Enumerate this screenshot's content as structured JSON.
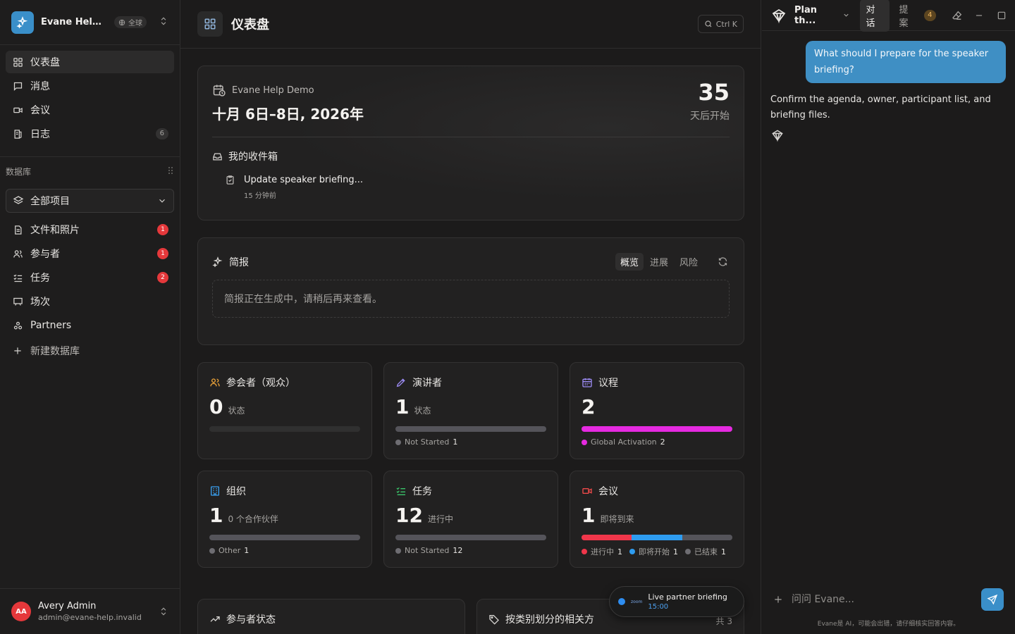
{
  "workspace": {
    "name": "Evane Help Demo",
    "scope_badge": "全球"
  },
  "sidebar": {
    "nav": [
      {
        "label": "仪表盘",
        "icon": "dashboard-icon",
        "active": true
      },
      {
        "label": "消息",
        "icon": "message-icon"
      },
      {
        "label": "会议",
        "icon": "video-icon"
      },
      {
        "label": "日志",
        "icon": "log-icon",
        "count": "6"
      }
    ],
    "db_header": "数据库",
    "db_select": "全部项目",
    "databases": [
      {
        "label": "文件和照片",
        "icon": "file-icon",
        "badge": "1"
      },
      {
        "label": "参与者",
        "icon": "users-icon",
        "badge": "1"
      },
      {
        "label": "任务",
        "icon": "checklist-icon",
        "badge": "2"
      },
      {
        "label": "场次",
        "icon": "presentation-icon"
      },
      {
        "label": "Partners",
        "icon": "partners-icon"
      }
    ],
    "new_db": "新建数据库"
  },
  "user": {
    "initials": "AA",
    "name": "Avery Admin",
    "email": "admin@evane-help.invalid"
  },
  "main": {
    "title": "仪表盘",
    "search_shortcut": "Ctrl K",
    "event": {
      "name": "Evane Help Demo",
      "dates": "十月 6日–8日, 2026年",
      "countdown": "35",
      "countdown_unit": "天后开始",
      "inbox_title": "我的收件箱",
      "inbox_item": "Update speaker briefing...",
      "inbox_time": "15 分钟前"
    },
    "briefing": {
      "title": "简报",
      "tabs": [
        "概览",
        "进展",
        "风险"
      ],
      "active_tab": 0,
      "placeholder": "简报正在生成中，请稍后再来查看。"
    },
    "stats": [
      {
        "title": "参会者（观众）",
        "icon": "users-icon",
        "icon_color": "#f0a63a",
        "value": "0",
        "unit": "状态",
        "segments": [],
        "legend": []
      },
      {
        "title": "演讲者",
        "icon": "pen-icon",
        "icon_color": "#9d8cf5",
        "value": "1",
        "unit": "状态",
        "segments": [
          {
            "color": "#55545a",
            "value": 1
          }
        ],
        "legend": [
          {
            "label": "Not Started",
            "count": "1",
            "color": "#6e6d72"
          }
        ]
      },
      {
        "title": "议程",
        "icon": "calendar-icon",
        "icon_color": "#9d8cf5",
        "value": "2",
        "unit": "",
        "segments": [
          {
            "color": "#e52ae0",
            "value": 2
          }
        ],
        "legend": [
          {
            "label": "Global Activation",
            "count": "2",
            "color": "#e52ae0"
          }
        ]
      },
      {
        "title": "组织",
        "icon": "building-icon",
        "icon_color": "#3aa0f0",
        "value": "1",
        "unit": "0 个合作伙伴",
        "segments": [
          {
            "color": "#55545a",
            "value": 1
          }
        ],
        "legend": [
          {
            "label": "Other",
            "count": "1",
            "color": "#6e6d72"
          }
        ]
      },
      {
        "title": "任务",
        "icon": "checklist-icon",
        "icon_color": "#3ac46a",
        "value": "12",
        "unit": "进行中",
        "segments": [
          {
            "color": "#55545a",
            "value": 12
          }
        ],
        "legend": [
          {
            "label": "Not Started",
            "count": "12",
            "color": "#6e6d72"
          }
        ]
      },
      {
        "title": "会议",
        "icon": "video-icon",
        "icon_color": "#f04a4a",
        "value": "1",
        "unit": "即将到来",
        "segments": [
          {
            "color": "#f0364a",
            "value": 1
          },
          {
            "color": "#2e9cf0",
            "value": 1
          },
          {
            "color": "#55545a",
            "value": 1
          }
        ],
        "legend": [
          {
            "label": "进行中",
            "count": "1",
            "color": "#f0364a"
          },
          {
            "label": "即将开始",
            "count": "1",
            "color": "#2e9cf0"
          },
          {
            "label": "已结束",
            "count": "1",
            "color": "#6e6d72"
          }
        ]
      }
    ],
    "bottom_cards": [
      {
        "title": "参与者状态",
        "right": ""
      },
      {
        "title": "按类别划分的相关方",
        "right": "共 3"
      }
    ],
    "toast": {
      "logo": "zoom",
      "title": "Live partner briefing",
      "time": "15:00"
    }
  },
  "chat": {
    "title": "Plan th...",
    "tabs": [
      "对话",
      "提案"
    ],
    "proposal_count": "4",
    "user_message": "What should I prepare for the speaker briefing?",
    "assistant_message": "Confirm the agenda, owner, participant list, and briefing files.",
    "input_placeholder": "问问 Evane...",
    "disclaimer": "Evane是 AI，可能会出错，请仔细核实回答内容。"
  }
}
